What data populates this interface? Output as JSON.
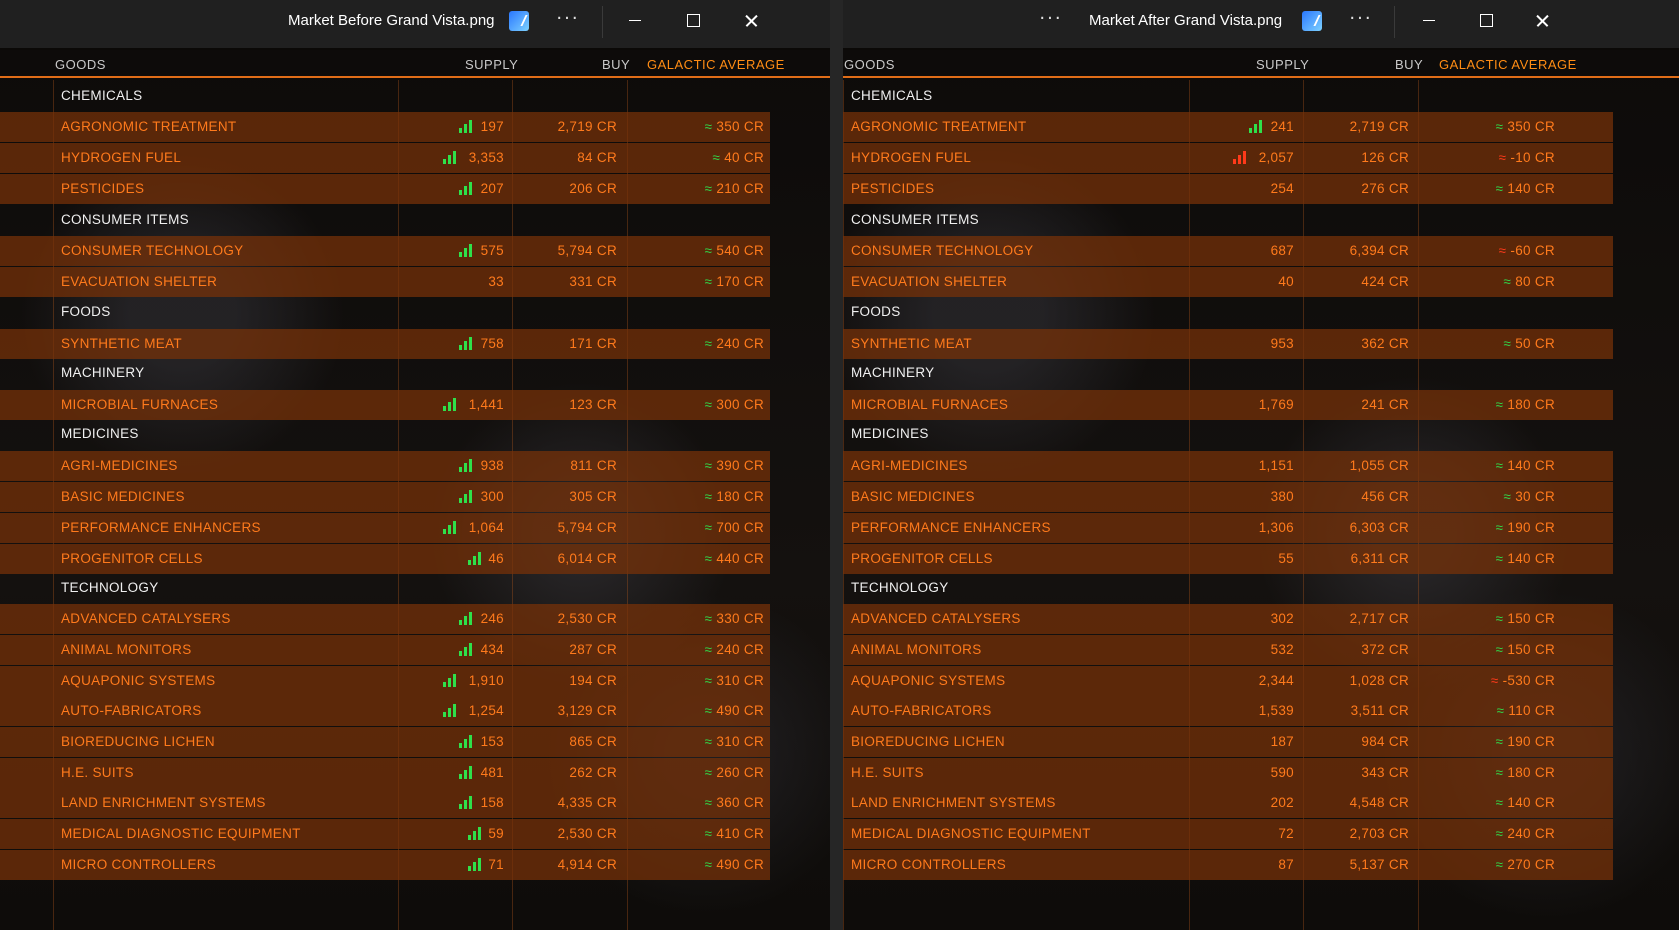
{
  "windows": [
    {
      "title": "Market Before Grand Vista.png",
      "headers": {
        "goods": "GOODS",
        "supply": "SUPPLY",
        "buy": "BUY",
        "avg": "GALACTIC AVERAGE"
      },
      "rows": [
        {
          "type": "cat",
          "name": "CHEMICALS"
        },
        {
          "type": "item",
          "name": "AGRONOMIC TREATMENT",
          "supply": "197",
          "bars": "green",
          "buy": "2,719 CR",
          "avg": "≈ 350 CR",
          "avg_color": "green"
        },
        {
          "type": "item",
          "name": "HYDROGEN FUEL",
          "supply": "3,353",
          "bars": "green",
          "buy": "84 CR",
          "avg": "≈ 40 CR",
          "avg_color": "green"
        },
        {
          "type": "item",
          "name": "PESTICIDES",
          "supply": "207",
          "bars": "green",
          "buy": "206 CR",
          "avg": "≈ 210 CR",
          "avg_color": "green"
        },
        {
          "type": "cat",
          "name": "CONSUMER ITEMS"
        },
        {
          "type": "item",
          "name": "CONSUMER TECHNOLOGY",
          "supply": "575",
          "bars": "green",
          "buy": "5,794 CR",
          "avg": "≈ 540 CR",
          "avg_color": "green"
        },
        {
          "type": "item",
          "name": "EVACUATION SHELTER",
          "supply": "33",
          "bars": "none",
          "buy": "331 CR",
          "avg": "≈ 170 CR",
          "avg_color": "green"
        },
        {
          "type": "cat",
          "name": "FOODS"
        },
        {
          "type": "item",
          "name": "SYNTHETIC MEAT",
          "supply": "758",
          "bars": "green",
          "buy": "171 CR",
          "avg": "≈ 240 CR",
          "avg_color": "green"
        },
        {
          "type": "cat",
          "name": "MACHINERY"
        },
        {
          "type": "item",
          "name": "MICROBIAL FURNACES",
          "supply": "1,441",
          "bars": "green",
          "buy": "123 CR",
          "avg": "≈ 300 CR",
          "avg_color": "green"
        },
        {
          "type": "cat",
          "name": "MEDICINES"
        },
        {
          "type": "item",
          "name": "AGRI-MEDICINES",
          "supply": "938",
          "bars": "green",
          "buy": "811 CR",
          "avg": "≈ 390 CR",
          "avg_color": "green"
        },
        {
          "type": "item",
          "name": "BASIC MEDICINES",
          "supply": "300",
          "bars": "green",
          "buy": "305 CR",
          "avg": "≈ 180 CR",
          "avg_color": "green"
        },
        {
          "type": "item",
          "name": "PERFORMANCE ENHANCERS",
          "supply": "1,064",
          "bars": "green",
          "buy": "5,794 CR",
          "avg": "≈ 700 CR",
          "avg_color": "green"
        },
        {
          "type": "item",
          "name": "PROGENITOR CELLS",
          "supply": "46",
          "bars": "green",
          "buy": "6,014 CR",
          "avg": "≈ 440 CR",
          "avg_color": "green"
        },
        {
          "type": "cat",
          "name": "TECHNOLOGY"
        },
        {
          "type": "item",
          "name": "ADVANCED CATALYSERS",
          "supply": "246",
          "bars": "green",
          "buy": "2,530 CR",
          "avg": "≈ 330 CR",
          "avg_color": "green"
        },
        {
          "type": "item",
          "name": "ANIMAL MONITORS",
          "supply": "434",
          "bars": "green",
          "buy": "287 CR",
          "avg": "≈ 240 CR",
          "avg_color": "green"
        },
        {
          "type": "item",
          "name": "AQUAPONIC SYSTEMS",
          "supply": "1,910",
          "bars": "green",
          "buy": "194 CR",
          "avg": "≈ 310 CR",
          "avg_color": "green"
        },
        {
          "type": "item",
          "name": "AUTO-FABRICATORS",
          "supply": "1,254",
          "bars": "green",
          "buy": "3,129 CR",
          "avg": "≈ 490 CR",
          "avg_color": "green"
        },
        {
          "type": "item",
          "name": "BIOREDUCING LICHEN",
          "supply": "153",
          "bars": "green",
          "buy": "865 CR",
          "avg": "≈ 310 CR",
          "avg_color": "green"
        },
        {
          "type": "item",
          "name": "H.E. SUITS",
          "supply": "481",
          "bars": "green",
          "buy": "262 CR",
          "avg": "≈ 260 CR",
          "avg_color": "green"
        },
        {
          "type": "item",
          "name": "LAND ENRICHMENT SYSTEMS",
          "supply": "158",
          "bars": "green",
          "buy": "4,335 CR",
          "avg": "≈ 360 CR",
          "avg_color": "green"
        },
        {
          "type": "item",
          "name": "MEDICAL DIAGNOSTIC EQUIPMENT",
          "supply": "59",
          "bars": "green",
          "buy": "2,530 CR",
          "avg": "≈ 410 CR",
          "avg_color": "green"
        },
        {
          "type": "item",
          "name": "MICRO CONTROLLERS",
          "supply": "71",
          "bars": "green",
          "buy": "4,914 CR",
          "avg": "≈ 490 CR",
          "avg_color": "green"
        }
      ]
    },
    {
      "title": "Market After Grand Vista.png",
      "headers": {
        "goods": "GOODS",
        "supply": "SUPPLY",
        "buy": "BUY",
        "avg": "GALACTIC AVERAGE"
      },
      "rows": [
        {
          "type": "cat",
          "name": "CHEMICALS"
        },
        {
          "type": "item",
          "name": "AGRONOMIC TREATMENT",
          "supply": "241",
          "bars": "green",
          "buy": "2,719 CR",
          "avg": "≈ 350 CR",
          "avg_color": "green"
        },
        {
          "type": "item",
          "name": "HYDROGEN FUEL",
          "supply": "2,057",
          "bars": "red",
          "buy": "126 CR",
          "avg": "≈ -10 CR",
          "avg_color": "red"
        },
        {
          "type": "item",
          "name": "PESTICIDES",
          "supply": "254",
          "bars": "none",
          "buy": "276 CR",
          "avg": "≈ 140 CR",
          "avg_color": "green"
        },
        {
          "type": "cat",
          "name": "CONSUMER ITEMS"
        },
        {
          "type": "item",
          "name": "CONSUMER TECHNOLOGY",
          "supply": "687",
          "bars": "none",
          "buy": "6,394 CR",
          "avg": "≈ -60 CR",
          "avg_color": "red"
        },
        {
          "type": "item",
          "name": "EVACUATION SHELTER",
          "supply": "40",
          "bars": "none",
          "buy": "424 CR",
          "avg": "≈ 80 CR",
          "avg_color": "green"
        },
        {
          "type": "cat",
          "name": "FOODS"
        },
        {
          "type": "item",
          "name": "SYNTHETIC MEAT",
          "supply": "953",
          "bars": "none",
          "buy": "362 CR",
          "avg": "≈ 50 CR",
          "avg_color": "green"
        },
        {
          "type": "cat",
          "name": "MACHINERY"
        },
        {
          "type": "item",
          "name": "MICROBIAL FURNACES",
          "supply": "1,769",
          "bars": "none",
          "buy": "241 CR",
          "avg": "≈ 180 CR",
          "avg_color": "green"
        },
        {
          "type": "cat",
          "name": "MEDICINES"
        },
        {
          "type": "item",
          "name": "AGRI-MEDICINES",
          "supply": "1,151",
          "bars": "none",
          "buy": "1,055 CR",
          "avg": "≈ 140 CR",
          "avg_color": "green"
        },
        {
          "type": "item",
          "name": "BASIC MEDICINES",
          "supply": "380",
          "bars": "none",
          "buy": "456 CR",
          "avg": "≈ 30 CR",
          "avg_color": "green"
        },
        {
          "type": "item",
          "name": "PERFORMANCE ENHANCERS",
          "supply": "1,306",
          "bars": "none",
          "buy": "6,303 CR",
          "avg": "≈ 190 CR",
          "avg_color": "green"
        },
        {
          "type": "item",
          "name": "PROGENITOR CELLS",
          "supply": "55",
          "bars": "none",
          "buy": "6,311 CR",
          "avg": "≈ 140 CR",
          "avg_color": "green"
        },
        {
          "type": "cat",
          "name": "TECHNOLOGY"
        },
        {
          "type": "item",
          "name": "ADVANCED CATALYSERS",
          "supply": "302",
          "bars": "none",
          "buy": "2,717 CR",
          "avg": "≈ 150 CR",
          "avg_color": "green"
        },
        {
          "type": "item",
          "name": "ANIMAL MONITORS",
          "supply": "532",
          "bars": "none",
          "buy": "372 CR",
          "avg": "≈ 150 CR",
          "avg_color": "green"
        },
        {
          "type": "item",
          "name": "AQUAPONIC SYSTEMS",
          "supply": "2,344",
          "bars": "none",
          "buy": "1,028 CR",
          "avg": "≈ -530 CR",
          "avg_color": "red"
        },
        {
          "type": "item",
          "name": "AUTO-FABRICATORS",
          "supply": "1,539",
          "bars": "none",
          "buy": "3,511 CR",
          "avg": "≈ 110 CR",
          "avg_color": "green"
        },
        {
          "type": "item",
          "name": "BIOREDUCING LICHEN",
          "supply": "187",
          "bars": "none",
          "buy": "984 CR",
          "avg": "≈ 190 CR",
          "avg_color": "green"
        },
        {
          "type": "item",
          "name": "H.E. SUITS",
          "supply": "590",
          "bars": "none",
          "buy": "343 CR",
          "avg": "≈ 180 CR",
          "avg_color": "green"
        },
        {
          "type": "item",
          "name": "LAND ENRICHMENT SYSTEMS",
          "supply": "202",
          "bars": "none",
          "buy": "4,548 CR",
          "avg": "≈ 140 CR",
          "avg_color": "green"
        },
        {
          "type": "item",
          "name": "MEDICAL DIAGNOSTIC EQUIPMENT",
          "supply": "72",
          "bars": "none",
          "buy": "2,703 CR",
          "avg": "≈ 240 CR",
          "avg_color": "green"
        },
        {
          "type": "item",
          "name": "MICRO CONTROLLERS",
          "supply": "87",
          "bars": "none",
          "buy": "5,137 CR",
          "avg": "≈ 270 CR",
          "avg_color": "green"
        }
      ]
    }
  ],
  "colors": {
    "accent": "#e06d18",
    "item_text": "#ff7a1c",
    "avg_green": "#30d94a",
    "avg_red": "#ff3a1a"
  }
}
